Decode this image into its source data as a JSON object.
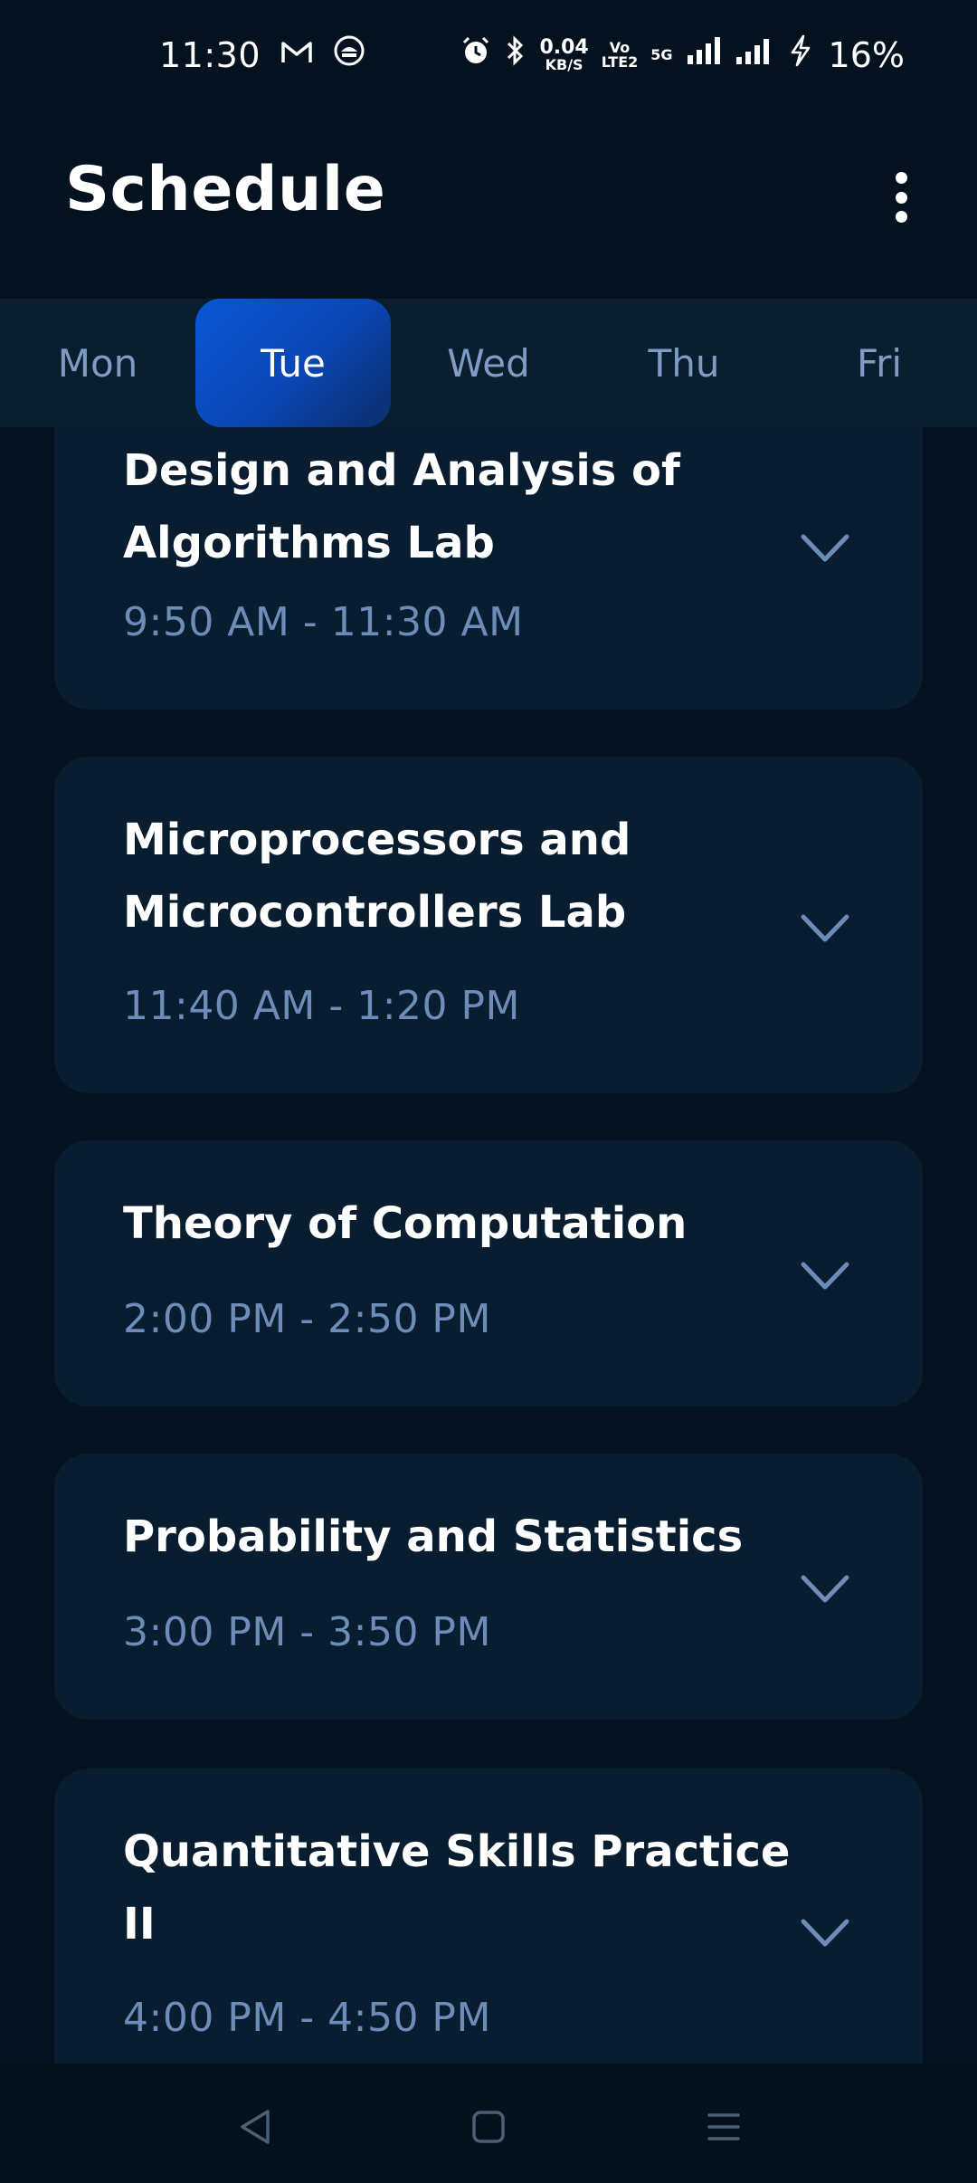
{
  "status_bar": {
    "time": "11:30",
    "net_speed_value": "0.04",
    "net_speed_unit": "KB/S",
    "volte_top": "Vo",
    "volte_bottom": "LTE2",
    "network_type": "5G",
    "battery": "16%"
  },
  "header": {
    "title": "Schedule"
  },
  "days": [
    {
      "label": "Mon",
      "active": false
    },
    {
      "label": "Tue",
      "active": true
    },
    {
      "label": "Wed",
      "active": false
    },
    {
      "label": "Thu",
      "active": false
    },
    {
      "label": "Fri",
      "active": false
    }
  ],
  "schedule": [
    {
      "title": "Design and Analysis of Algorithms Lab",
      "time": "9:50 AM - 11:30 AM"
    },
    {
      "title": "Microprocessors and Microcontrollers Lab",
      "time": "11:40 AM - 1:20 PM"
    },
    {
      "title": "Theory of Computation",
      "time": "2:00 PM - 2:50 PM"
    },
    {
      "title": "Probability and Statistics",
      "time": "3:00 PM - 3:50 PM"
    },
    {
      "title": "Quantitative Skills Practice II",
      "time": "4:00 PM - 4:50 PM"
    }
  ],
  "icons": {
    "more": "more-vertical-icon",
    "expand": "chevron-down-icon",
    "nav_back": "back-triangle-icon",
    "nav_home": "home-square-icon",
    "nav_recents": "recents-menu-icon"
  },
  "colors": {
    "background": "#04121f",
    "card": "#091d30",
    "tab_strip": "#0a1e30",
    "active_tab": "#0b56d6",
    "muted_text": "#6e8cb8"
  }
}
